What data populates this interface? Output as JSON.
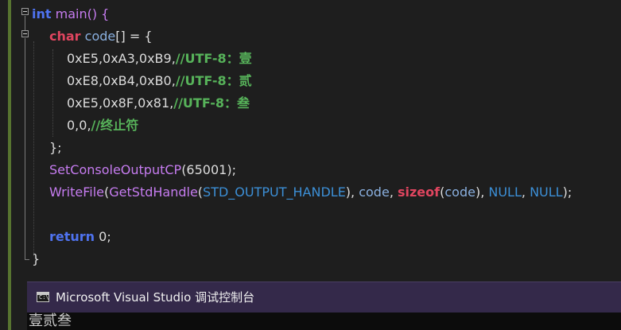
{
  "editor": {
    "lines": [
      [
        {
          "t": "int",
          "c": "kw-blue"
        },
        {
          "t": " main() {",
          "c": "fn"
        }
      ],
      [
        {
          "t": "char",
          "c": "kw-red"
        },
        {
          "t": " ",
          "c": "punc"
        },
        {
          "t": "code",
          "c": "var"
        },
        {
          "t": "[] = {",
          "c": "punc"
        }
      ],
      [
        {
          "t": "0xE5,0xA3,0xB9,",
          "c": "num"
        },
        {
          "t": "//UTF-8：壹",
          "c": "comment"
        }
      ],
      [
        {
          "t": "0xE8,0xB4,0xB0,",
          "c": "num"
        },
        {
          "t": "//UTF-8：贰",
          "c": "comment"
        }
      ],
      [
        {
          "t": "0xE5,0x8F,0x81,",
          "c": "num"
        },
        {
          "t": "//UTF-8：叁",
          "c": "comment"
        }
      ],
      [
        {
          "t": "0,0,",
          "c": "num"
        },
        {
          "t": "//终止符",
          "c": "comment"
        }
      ],
      [
        {
          "t": "};",
          "c": "punc"
        }
      ],
      [
        {
          "t": "SetConsoleOutputCP",
          "c": "fn"
        },
        {
          "t": "(65001);",
          "c": "punc"
        }
      ],
      [
        {
          "t": "WriteFile",
          "c": "fn"
        },
        {
          "t": "(",
          "c": "punc"
        },
        {
          "t": "GetStdHandle",
          "c": "fn"
        },
        {
          "t": "(",
          "c": "punc"
        },
        {
          "t": "STD_OUTPUT_HANDLE",
          "c": "macro"
        },
        {
          "t": "), ",
          "c": "punc"
        },
        {
          "t": "code",
          "c": "var"
        },
        {
          "t": ", ",
          "c": "punc"
        },
        {
          "t": "sizeof",
          "c": "kw-red"
        },
        {
          "t": "(",
          "c": "punc"
        },
        {
          "t": "code",
          "c": "var"
        },
        {
          "t": "), ",
          "c": "punc"
        },
        {
          "t": "NULL",
          "c": "macro"
        },
        {
          "t": ", ",
          "c": "punc"
        },
        {
          "t": "NULL",
          "c": "macro"
        },
        {
          "t": ");",
          "c": "punc"
        }
      ],
      [],
      [
        {
          "t": "return",
          "c": "kw-blue"
        },
        {
          "t": " 0;",
          "c": "punc"
        }
      ],
      [
        {
          "t": "}",
          "c": "punc"
        }
      ]
    ]
  },
  "console": {
    "icon": "console-app-icon",
    "icon_glyph": "C:\\",
    "title": "Microsoft Visual Studio 调试控制台",
    "output": "壹贰叁"
  },
  "colors": {
    "background": "#1e1e1e",
    "keyword_blue": "#4f73f0",
    "keyword_red": "#e0455f",
    "function": "#c67cf0",
    "variable": "#8ab0e0",
    "macro": "#3c8fd6",
    "comment": "#57b35a",
    "change_bar": "#577430",
    "console_titlebar": "#34294a"
  }
}
